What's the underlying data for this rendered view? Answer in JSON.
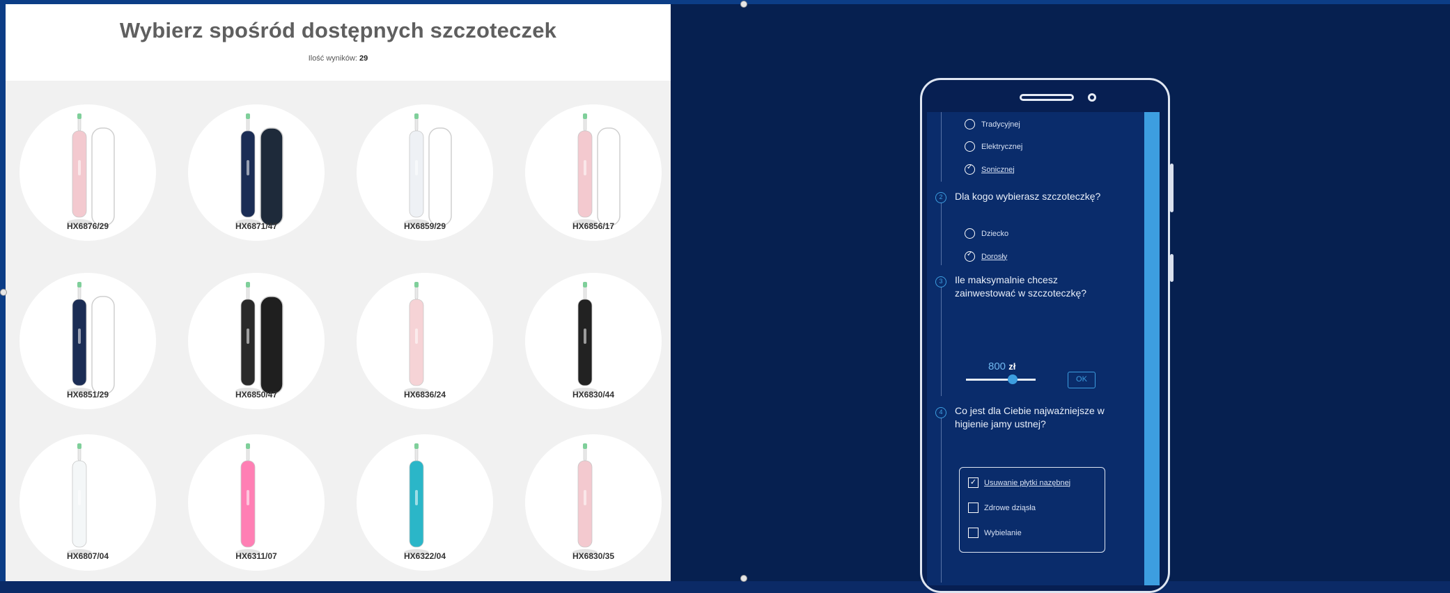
{
  "catalog": {
    "title": "Wybierz spośród dostępnych szczoteczek",
    "count_label": "Ilość wyników:",
    "count_value": "29",
    "products": [
      {
        "model": "HX6876/29",
        "brush_color": "#f3c9cf",
        "has_case": true,
        "case_color": "#ffffff"
      },
      {
        "model": "HX6871/47",
        "brush_color": "#1b2d55",
        "has_case": true,
        "case_color": "#1e2a3a"
      },
      {
        "model": "HX6859/29",
        "brush_color": "#eef1f5",
        "has_case": true,
        "case_color": "#ffffff"
      },
      {
        "model": "HX6856/17",
        "brush_color": "#f3c9cf",
        "has_case": true,
        "case_color": "#ffffff"
      },
      {
        "model": "HX6851/29",
        "brush_color": "#1b2d55",
        "has_case": true,
        "case_color": "#ffffff"
      },
      {
        "model": "HX6850/47",
        "brush_color": "#2a2a2a",
        "has_case": true,
        "case_color": "#1f1f1f"
      },
      {
        "model": "HX6836/24",
        "brush_color": "#f6d3d6",
        "has_case": false,
        "case_color": ""
      },
      {
        "model": "HX6830/44",
        "brush_color": "#222222",
        "has_case": false,
        "case_color": ""
      },
      {
        "model": "HX6807/04",
        "brush_color": "#f4f7f8",
        "has_case": false,
        "case_color": ""
      },
      {
        "model": "HX6311/07",
        "brush_color": "#ff7fb4",
        "has_case": false,
        "case_color": ""
      },
      {
        "model": "HX6322/04",
        "brush_color": "#2bb6c8",
        "has_case": false,
        "case_color": ""
      },
      {
        "model": "HX6830/35",
        "brush_color": "#f3c9cf",
        "has_case": false,
        "case_color": ""
      }
    ]
  },
  "quiz": {
    "q1_options": [
      {
        "label": "Tradycyjnej",
        "selected": false
      },
      {
        "label": "Elektrycznej",
        "selected": false
      },
      {
        "label": "Sonicznej",
        "selected": true
      }
    ],
    "q2_number": "2",
    "q2_text": "Dla kogo wybierasz szczoteczkę?",
    "q2_options": [
      {
        "label": "Dziecko",
        "selected": false
      },
      {
        "label": "Dorosły",
        "selected": true
      }
    ],
    "q3_number": "3",
    "q3_text": "Ile maksymalnie chcesz zainwestować w szczoteczkę?",
    "price_value": "800",
    "price_unit": "zł",
    "price_fraction": 0.6,
    "ok_label": "OK",
    "q4_number": "4",
    "q4_text": "Co jest dla Ciebie najważniejsze w higienie jamy ustnej?",
    "q4_options": [
      {
        "label": "Usuwanie płytki nazębnej",
        "checked": true
      },
      {
        "label": "Zdrowe dziąsła",
        "checked": false
      },
      {
        "label": "Wybielanie",
        "checked": false
      }
    ]
  }
}
